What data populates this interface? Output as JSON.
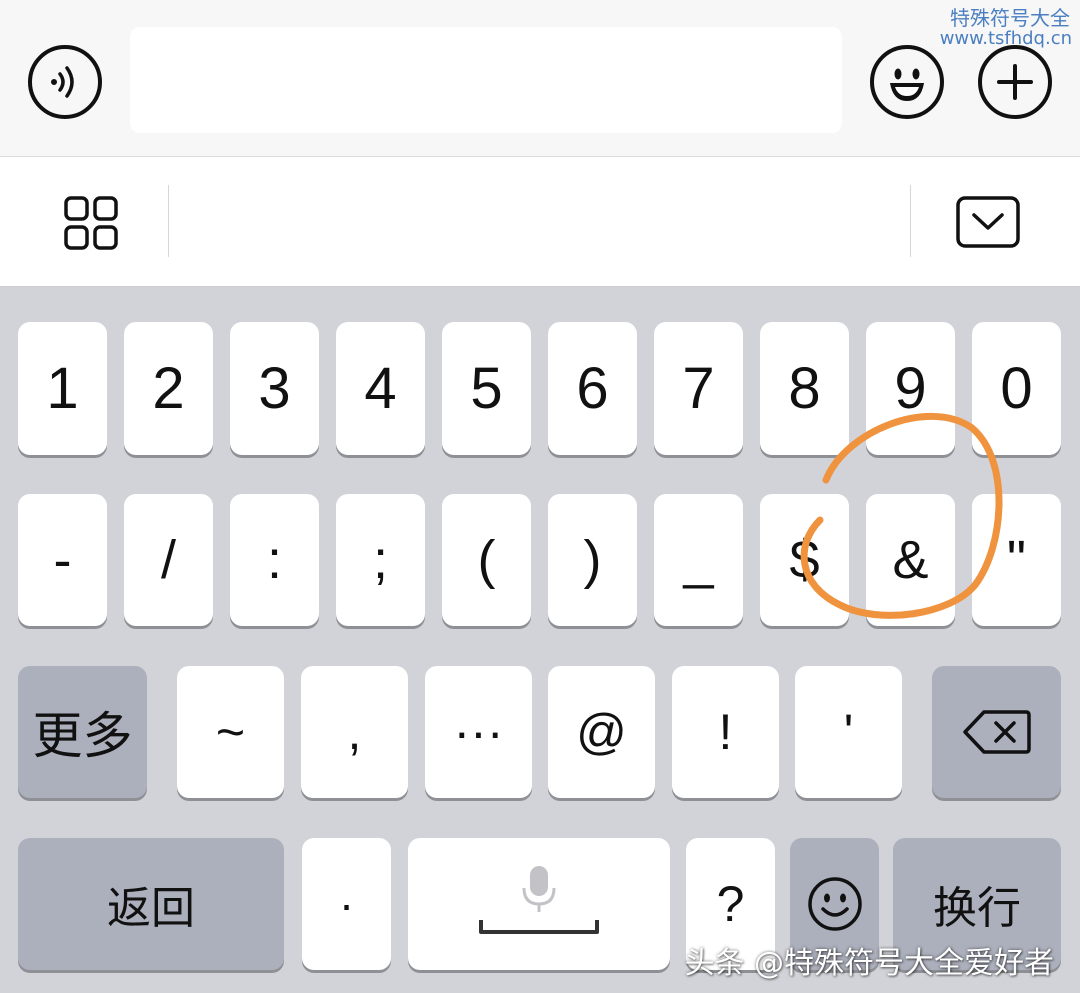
{
  "watermark": {
    "title": "特殊符号大全",
    "url": "www.tsfhdq.cn"
  },
  "input_bar": {
    "voice_icon": "voice-icon",
    "message_value": "",
    "emoji_icon": "smiley-icon",
    "add_icon": "plus-icon"
  },
  "toolbar": {
    "menu_icon": "grid-icon",
    "collapse_icon": "chevron-down-icon"
  },
  "keyboard": {
    "row1": [
      {
        "id": "1",
        "label": "1"
      },
      {
        "id": "2",
        "label": "2"
      },
      {
        "id": "3",
        "label": "3"
      },
      {
        "id": "4",
        "label": "4"
      },
      {
        "id": "5",
        "label": "5"
      },
      {
        "id": "6",
        "label": "6"
      },
      {
        "id": "7",
        "label": "7"
      },
      {
        "id": "8",
        "label": "8"
      },
      {
        "id": "9",
        "label": "9"
      },
      {
        "id": "0",
        "label": "0"
      }
    ],
    "row2": [
      {
        "id": "hyphen",
        "label": "-"
      },
      {
        "id": "slash",
        "label": "/"
      },
      {
        "id": "colon",
        "label": ":"
      },
      {
        "id": "semicolon",
        "label": ";"
      },
      {
        "id": "lparen",
        "label": "("
      },
      {
        "id": "rparen",
        "label": ")"
      },
      {
        "id": "underscore",
        "label": "_"
      },
      {
        "id": "dollar",
        "label": "$"
      },
      {
        "id": "ampersand",
        "label": "&"
      },
      {
        "id": "quote",
        "label": "\""
      }
    ],
    "row3": {
      "more_label": "更多",
      "keys": [
        {
          "id": "tilde",
          "label": "~"
        },
        {
          "id": "comma",
          "label": ","
        },
        {
          "id": "ellipsis",
          "label": "···"
        },
        {
          "id": "at",
          "label": "@"
        },
        {
          "id": "exclaim",
          "label": "!"
        },
        {
          "id": "apostrophe",
          "label": "'"
        }
      ],
      "delete_icon": "backspace-icon"
    },
    "row4": {
      "back_label": "返回",
      "dot_label": "·",
      "space_icon": "microphone-icon",
      "question_label": "?",
      "emoji_icon": "smiley-icon",
      "enter_label": "换行"
    }
  },
  "annotation": {
    "color": "#f0933f",
    "target": "ampersand"
  },
  "credit": "头条 @特殊符号大全爱好者"
}
